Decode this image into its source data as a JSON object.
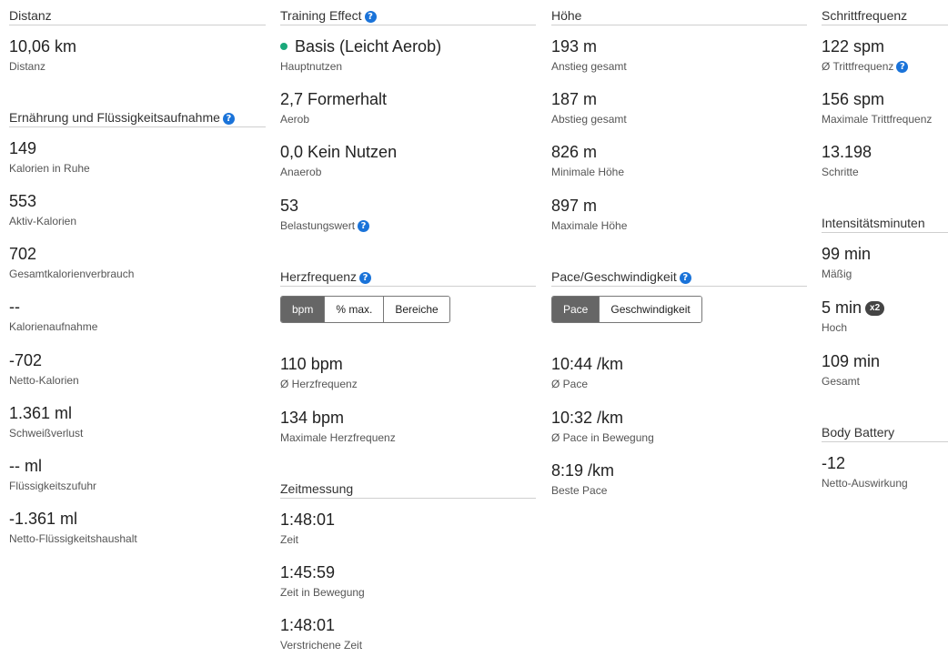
{
  "col1": {
    "distance": {
      "title": "Distanz",
      "value": "10,06 km",
      "label": "Distanz"
    },
    "nutrition": {
      "title": "Ernährung und Flüssigkeitsaufnahme",
      "items": [
        {
          "value": "149",
          "label": "Kalorien in Ruhe"
        },
        {
          "value": "553",
          "label": "Aktiv-Kalorien"
        },
        {
          "value": "702",
          "label": "Gesamtkalorienverbrauch"
        },
        {
          "value": "--",
          "label": "Kalorienaufnahme"
        },
        {
          "value": "-702",
          "label": "Netto-Kalorien"
        },
        {
          "value": "1.361 ml",
          "label": "Schweißverlust"
        },
        {
          "value": "-- ml",
          "label": "Flüssigkeitszufuhr"
        },
        {
          "value": "-1.361 ml",
          "label": "Netto-Flüssigkeitshaushalt"
        }
      ]
    }
  },
  "col2": {
    "training": {
      "title": "Training Effect",
      "primary": {
        "value": "Basis (Leicht Aerob)",
        "label": "Hauptnutzen",
        "dot_color": "#1aa87a"
      },
      "aerobic": {
        "value": "2,7 Formerhalt",
        "label": "Aerob"
      },
      "anaerobic": {
        "value": "0,0 Kein Nutzen",
        "label": "Anaerob"
      },
      "load": {
        "value": "53",
        "label": "Belastungswert"
      }
    },
    "heart": {
      "title": "Herzfrequenz",
      "tabs": [
        "bpm",
        "% max.",
        "Bereiche"
      ],
      "active_tab": "bpm",
      "avg": {
        "value": "110 bpm",
        "label": "Ø Herzfrequenz"
      },
      "max": {
        "value": "134 bpm",
        "label": "Maximale Herzfrequenz"
      }
    },
    "timing": {
      "title": "Zeitmessung",
      "items": [
        {
          "value": "1:48:01",
          "label": "Zeit"
        },
        {
          "value": "1:45:59",
          "label": "Zeit in Bewegung"
        },
        {
          "value": "1:48:01",
          "label": "Verstrichene Zeit"
        }
      ]
    }
  },
  "col3": {
    "elevation": {
      "title": "Höhe",
      "items": [
        {
          "value": "193 m",
          "label": "Anstieg gesamt"
        },
        {
          "value": "187 m",
          "label": "Abstieg gesamt"
        },
        {
          "value": "826 m",
          "label": "Minimale Höhe"
        },
        {
          "value": "897 m",
          "label": "Maximale Höhe"
        }
      ]
    },
    "pace": {
      "title": "Pace/Geschwindigkeit",
      "tabs": [
        "Pace",
        "Geschwindigkeit"
      ],
      "active_tab": "Pace",
      "items": [
        {
          "value": "10:44 /km",
          "label": "Ø Pace"
        },
        {
          "value": "10:32 /km",
          "label": "Ø Pace in Bewegung"
        },
        {
          "value": "8:19 /km",
          "label": "Beste Pace"
        }
      ]
    }
  },
  "col4": {
    "cadence": {
      "title": "Schrittfrequenz",
      "avg": {
        "value": "122 spm",
        "label": "Ø Trittfrequenz"
      },
      "max": {
        "value": "156 spm",
        "label": "Maximale Trittfrequenz"
      },
      "steps": {
        "value": "13.198",
        "label": "Schritte"
      }
    },
    "intensity": {
      "title": "Intensitätsminuten",
      "moderate": {
        "value": "99 min",
        "label": "Mäßig"
      },
      "high": {
        "value": "5 min",
        "label": "Hoch",
        "badge": "x2"
      },
      "total": {
        "value": "109 min",
        "label": "Gesamt"
      }
    },
    "body_battery": {
      "title": "Body Battery",
      "net": {
        "value": "-12",
        "label": "Netto-Auswirkung"
      }
    }
  },
  "colors": {
    "help_icon": "#1a73d9",
    "active_tab_bg": "#666666",
    "divider": "#cfcfcf"
  }
}
